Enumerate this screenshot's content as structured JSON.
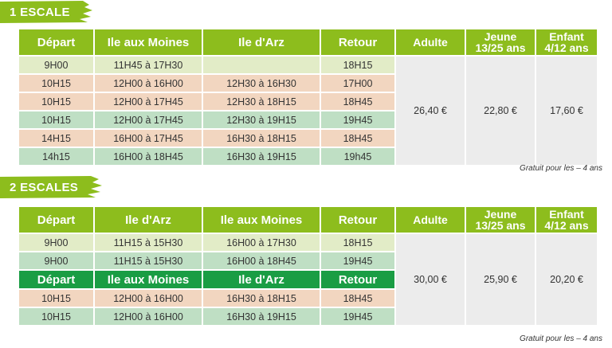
{
  "section1": {
    "title": "1 ESCALE",
    "headers": [
      "Départ",
      "Ile aux Moines",
      "Ile d'Arz",
      "Retour",
      "Adulte",
      "Jeune 13/25 ans",
      "Enfant 4/12 ans"
    ],
    "rows": [
      {
        "style": "light",
        "cells": [
          "9H00",
          "11H45 à 17H30",
          "",
          "18H15"
        ]
      },
      {
        "style": "salmon",
        "cells": [
          "10H15",
          "12H00 à 16H00",
          "12H30 à 16H30",
          "17H00"
        ]
      },
      {
        "style": "salmon",
        "cells": [
          "10H15",
          "12H00 à 17H45",
          "12H30 à 18H15",
          "18H45"
        ]
      },
      {
        "style": "green",
        "cells": [
          "10H15",
          "12H00 à 17H45",
          "12H30 à 19H15",
          "19H45"
        ]
      },
      {
        "style": "salmon",
        "cells": [
          "14H15",
          "16H00 à 17H45",
          "16H30 à 18H15",
          "18H45"
        ]
      },
      {
        "style": "green",
        "cells": [
          "14h15",
          "16H00 à 18H45",
          "16H30 à 19H15",
          "19h45"
        ]
      }
    ],
    "prices": {
      "adulte": "26,40 €",
      "jeune": "22,80 €",
      "enfant": "17,60 €"
    },
    "note": "Gratuit pour les – 4 ans"
  },
  "section2": {
    "title": "2 ESCALES",
    "headers": [
      "Départ",
      "Ile d'Arz",
      "Ile aux Moines",
      "Retour",
      "Adulte",
      "Jeune 13/25 ans",
      "Enfant 4/12 ans"
    ],
    "rows_a": [
      {
        "style": "light",
        "cells": [
          "9H00",
          "11H15 à 15H30",
          "16H00 à 17H30",
          "18H15"
        ]
      },
      {
        "style": "green",
        "cells": [
          "9H00",
          "11H15 à 15H30",
          "16H00 à 18H45",
          "19H45"
        ]
      }
    ],
    "subheaders": [
      "Départ",
      "Ile aux Moines",
      "Ile d'Arz",
      "Retour"
    ],
    "rows_b": [
      {
        "style": "salmon",
        "cells": [
          "10H15",
          "12H00 à 16H00",
          "16H30 à 18H15",
          "18H45"
        ]
      },
      {
        "style": "green",
        "cells": [
          "10H15",
          "12H00 à 16H00",
          "16H30 à 19H15",
          "19H45"
        ]
      }
    ],
    "prices": {
      "adulte": "30,00 €",
      "jeune": "25,90 €",
      "enfant": "20,20 €"
    },
    "note": "Gratuit pour les – 4 ans"
  },
  "colors": {
    "header_green": "#8dbd1d",
    "subheader_green": "#1a9d44",
    "row_light": "#e2ecc7",
    "row_salmon": "#f2d6c0",
    "row_green": "#bfdfc4",
    "price_grey": "#ececec"
  }
}
